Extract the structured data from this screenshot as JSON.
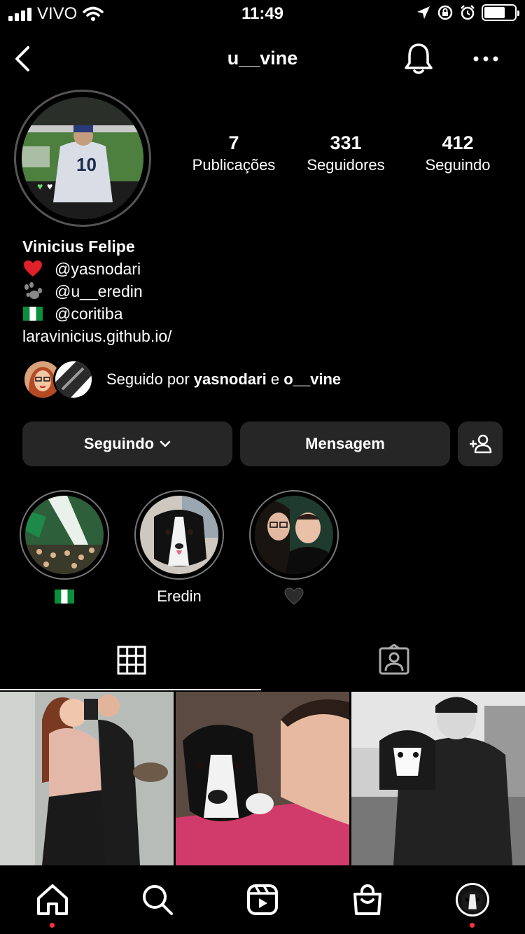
{
  "status_bar": {
    "carrier": "VIVO",
    "time": "11:49"
  },
  "header": {
    "username": "u__vine"
  },
  "profile": {
    "stats": [
      {
        "value": "7",
        "label": "Publicações"
      },
      {
        "value": "331",
        "label": "Seguidores"
      },
      {
        "value": "412",
        "label": "Seguindo"
      }
    ],
    "name": "Vinicius Felipe",
    "bio_lines": [
      {
        "icon": "heart-emoji-icon",
        "text": "@yasnodari"
      },
      {
        "icon": "paw-emoji-icon",
        "text": "@u__eredin"
      },
      {
        "icon": "nigeria-flag-emoji-icon",
        "text": "@coritiba"
      }
    ],
    "link": "laravinicius.github.io/",
    "followed_by": {
      "prefix": "Seguido por",
      "user1": "yasnodari",
      "conj": "e",
      "user2": "o__vine"
    }
  },
  "buttons": {
    "following": "Seguindo",
    "message": "Mensagem"
  },
  "highlights": [
    {
      "label": "",
      "icon": "nigeria-flag-emoji-icon"
    },
    {
      "label": "Eredin"
    },
    {
      "label": "",
      "icon": "black-heart-emoji-icon"
    }
  ],
  "colors": {
    "background": "#000000",
    "button": "#262626",
    "notification_dot": "#ff3040"
  }
}
